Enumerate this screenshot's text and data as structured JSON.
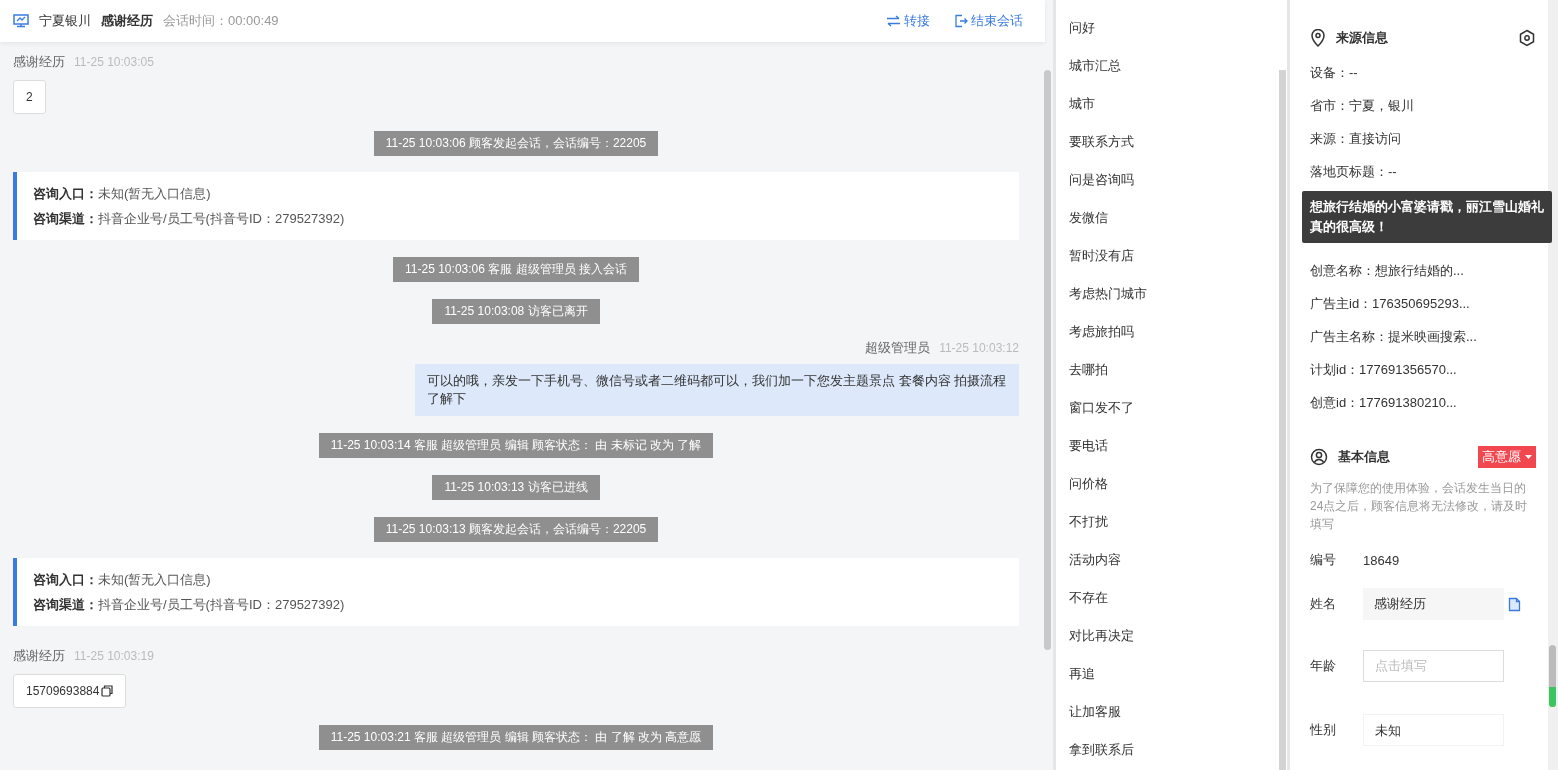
{
  "header": {
    "location": "宁夏银川",
    "visitor": "感谢经历",
    "timer": "会话时间：00:00:49",
    "actions": [
      {
        "kind": "transfer",
        "label": "转接"
      },
      {
        "kind": "end",
        "label": "结束会话"
      }
    ]
  },
  "chat": [
    {
      "kind": "visitor",
      "name": "感谢经历",
      "time": "11-25 10:03:05",
      "text": "2",
      "copyable": false
    },
    {
      "kind": "system",
      "text": "11-25 10:03:06 顾客发起会话，会话编号：22205"
    },
    {
      "kind": "entry",
      "rows": [
        {
          "label": "咨询入口：",
          "value": "未知(暂无入口信息)"
        },
        {
          "label": "咨询渠道：",
          "value": "抖音企业号/员工号(抖音号ID：279527392)"
        }
      ]
    },
    {
      "kind": "system",
      "text": "11-25 10:03:06 客服 超级管理员 接入会话"
    },
    {
      "kind": "system",
      "text": "11-25 10:03:08 访客已离开"
    },
    {
      "kind": "agent",
      "name": "超级管理员",
      "time": "11-25 10:03:12",
      "text": "可以的哦，亲发一下手机号、微信号或者二维码都可以，我们加一下您发主题景点 套餐内容 拍摄流程了解下"
    },
    {
      "kind": "system",
      "text": "11-25 10:03:14 客服 超级管理员 编辑 顾客状态： 由 未标记 改为 了解"
    },
    {
      "kind": "system",
      "text": "11-25 10:03:13 访客已进线"
    },
    {
      "kind": "system",
      "text": "11-25 10:03:13 顾客发起会话，会话编号：22205"
    },
    {
      "kind": "entry",
      "rows": [
        {
          "label": "咨询入口：",
          "value": "未知(暂无入口信息)"
        },
        {
          "label": "咨询渠道：",
          "value": "抖音企业号/员工号(抖音号ID：279527392)"
        }
      ]
    },
    {
      "kind": "visitor",
      "name": "感谢经历",
      "time": "11-25 10:03:19",
      "text": "15709693884",
      "copyable": true
    },
    {
      "kind": "system",
      "text": "11-25 10:03:21 客服 超级管理员 编辑 顾客状态： 由 了解 改为 高意愿"
    }
  ],
  "quick_replies": [
    "问好",
    "城市汇总",
    "城市",
    "要联系方式",
    "问是咨询吗",
    "发微信",
    "暂时没有店",
    "考虑热门城市",
    "考虑旅拍吗",
    "去哪拍",
    "窗口发不了",
    "要电话",
    "问价格",
    "不打扰",
    "活动内容",
    "不存在",
    "对比再决定",
    "再追",
    "让加客服",
    "拿到联系后"
  ],
  "source_info": {
    "title": "来源信息",
    "items_before": [
      "设备：--",
      "省市：宁夏，银川",
      "来源：直接访问",
      "落地页标题：--"
    ],
    "tooltip": "想旅行结婚的小富婆请戳，丽江雪山婚礼真的很高级！",
    "items_after": [
      "创意名称：想旅行结婚的...",
      "广告主id：176350695293...",
      "广告主名称：提米映画搜索...",
      "计划id：177691356570...",
      "创意id：177691380210..."
    ]
  },
  "basic_info": {
    "title": "基本信息",
    "intent": "高意愿",
    "notice": "为了保障您的使用体验，会话发生当日的24点之后，顾客信息将无法修改，请及时填写",
    "fields": [
      {
        "kind": "text",
        "label": "编号",
        "value": "18649"
      },
      {
        "kind": "filled",
        "label": "姓名",
        "value": "感谢经历"
      },
      {
        "kind": "input",
        "label": "年龄",
        "placeholder": "点击填写"
      },
      {
        "kind": "select",
        "label": "性别",
        "value": "未知"
      }
    ]
  }
}
